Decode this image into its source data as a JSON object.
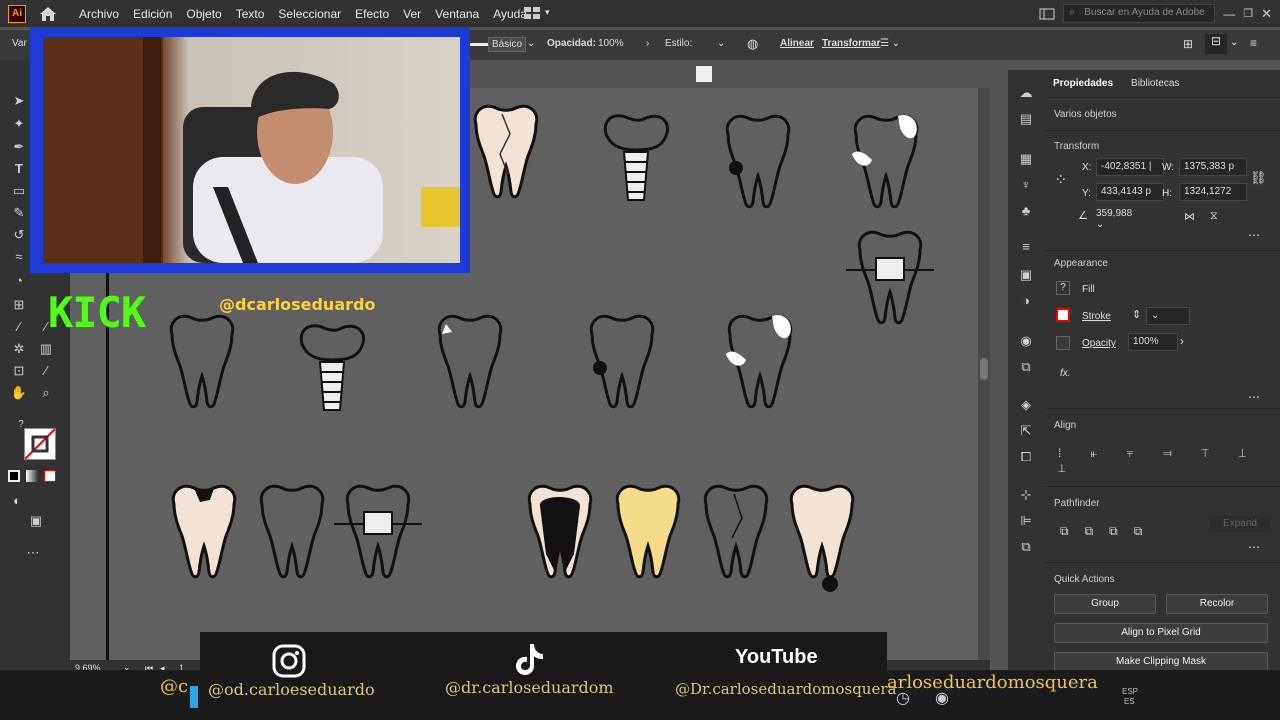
{
  "menu": {
    "app_logo": "Ai",
    "items": [
      "Archivo",
      "Edición",
      "Objeto",
      "Texto",
      "Seleccionar",
      "Efecto",
      "Ver",
      "Ventana",
      "Ayuda"
    ],
    "help_placeholder": "Buscar en Ayuda de Adobe"
  },
  "controlbar": {
    "selection_label": "Var",
    "stroke_style": "Básico",
    "opacity_label": "Opacidad:",
    "opacity_value": "100%",
    "style_label": "Estilo:",
    "align_link": "Alinear",
    "transform_link": "Transformar"
  },
  "panel": {
    "tabs": [
      "Propiedades",
      "Bibliotecas"
    ],
    "selection": "Varios objetos",
    "transform_title": "Transform",
    "x_label": "X:",
    "x_value": "-402,8351 |",
    "y_label": "Y:",
    "y_value": "433,4143 p",
    "w_label": "W:",
    "w_value": "1375,383 p",
    "h_label": "H:",
    "h_value": "1324,1272",
    "angle_value": "359,988",
    "appearance_title": "Appearance",
    "fill_label": "Fill",
    "stroke_label": "Stroke",
    "opacity_label": "Opacity",
    "opacity_value": "100%",
    "fx_label": "fx.",
    "align_title": "Align",
    "pathfinder_title": "Pathfinder",
    "expand_label": "Expand",
    "quick_actions_title": "Quick Actions",
    "group_button": "Group",
    "recolor_button": "Recolor",
    "align_pixel_button": "Align to Pixel Grid",
    "clipping_button": "Make Clipping Mask"
  },
  "status": {
    "zoom": "9,69%",
    "artboard": "1"
  },
  "overlay": {
    "kick_text": "KICK",
    "kick_handle": "@dcarloseduardo",
    "instagram_handle": "@od.carloeseduardo",
    "tiktok_handle": "@dr.carloseduardom",
    "youtube_label": "YouTube",
    "youtube_handle": "@Dr.carloseduardomosquera",
    "strip_left": "@c",
    "strip_right": "arloseduardomosquera",
    "lang": "ESP",
    "lang2": "ES"
  },
  "colors": {
    "menubar": "#323232",
    "canvas": "#606060",
    "webcam_border": "#1f3bd6",
    "kick_green": "#53fc18",
    "handle_gold": "#f1c542",
    "tooth_cream": "#f3e2d6",
    "tooth_yellow": "#f5dc8a"
  }
}
